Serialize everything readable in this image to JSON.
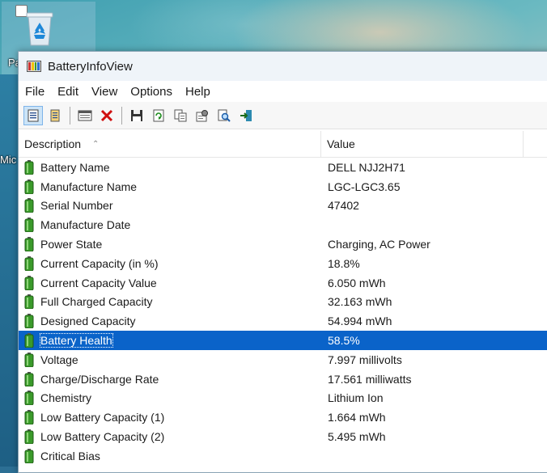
{
  "desktop": {
    "icon_label_fragment_1": "Pa",
    "icon_label_fragment_2": "Mic"
  },
  "window": {
    "title": "BatteryInfoView"
  },
  "menu": [
    "File",
    "Edit",
    "View",
    "Options",
    "Help"
  ],
  "toolbar": {
    "buttons": [
      "properties-icon",
      "copy-text-icon",
      "html-report-icon",
      "delete-icon",
      "save-icon",
      "refresh-icon",
      "copy-icon",
      "settings-icon",
      "find-icon",
      "exit-icon"
    ]
  },
  "table": {
    "columns": [
      "Description",
      "Value"
    ],
    "rows": [
      {
        "description": "Battery Name",
        "value": "DELL NJJ2H71"
      },
      {
        "description": "Manufacture Name",
        "value": "LGC-LGC3.65"
      },
      {
        "description": "Serial Number",
        "value": "47402"
      },
      {
        "description": "Manufacture Date",
        "value": ""
      },
      {
        "description": "Power State",
        "value": "Charging, AC Power"
      },
      {
        "description": "Current Capacity (in %)",
        "value": "18.8%"
      },
      {
        "description": "Current Capacity Value",
        "value": "6.050 mWh"
      },
      {
        "description": "Full Charged Capacity",
        "value": "32.163 mWh"
      },
      {
        "description": "Designed Capacity",
        "value": "54.994 mWh"
      },
      {
        "description": "Battery Health",
        "value": "58.5%"
      },
      {
        "description": "Voltage",
        "value": "7.997 millivolts"
      },
      {
        "description": "Charge/Discharge Rate",
        "value": "17.561 milliwatts"
      },
      {
        "description": "Chemistry",
        "value": "Lithium Ion"
      },
      {
        "description": "Low Battery Capacity (1)",
        "value": "1.664 mWh"
      },
      {
        "description": "Low Battery Capacity (2)",
        "value": "5.495 mWh"
      },
      {
        "description": "Critical Bias",
        "value": ""
      }
    ],
    "selected_row": "Battery Health"
  },
  "colors": {
    "selection": "#0a63c9",
    "battery_green": "#3a9a2a"
  }
}
